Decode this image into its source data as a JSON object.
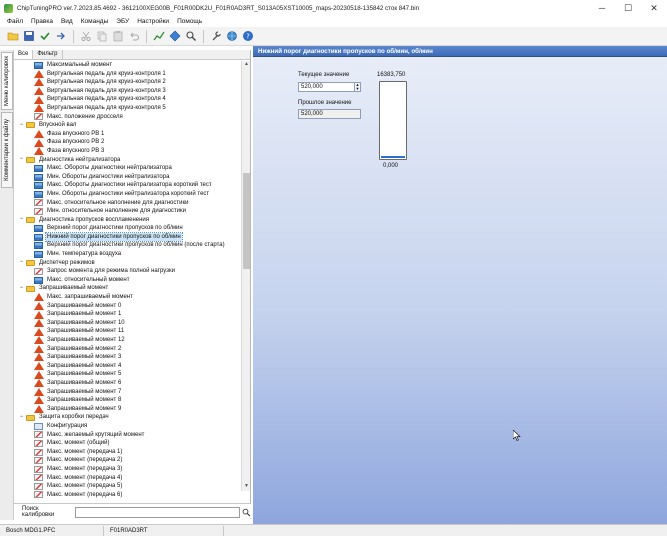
{
  "window": {
    "title": "ChipTuningPRO ver.7.2023.85.4692 - 3612100XEG00B_F01R00DK2U_F01R0AD3RT_S013A05XST10005_maps-20230518-135842 сток 847.bin",
    "minimize": "─",
    "maximize": "☐",
    "close": "✕"
  },
  "menu": {
    "items": [
      "Файл",
      "Правка",
      "Вид",
      "Команды",
      "ЭБУ",
      "Настройки",
      "Помощь"
    ]
  },
  "side_tabs": {
    "calibrations": "Меню калибровок",
    "comments": "Комментарии к файлу"
  },
  "left_tabs": {
    "all": "Все",
    "filter": "Фильтр"
  },
  "tree": [
    {
      "type": "map",
      "indent": 2,
      "label": "Максимальный момент"
    },
    {
      "type": "tri",
      "indent": 2,
      "label": "Виртуальная педаль для круиз-контроля 1"
    },
    {
      "type": "tri",
      "indent": 2,
      "label": "Виртуальная педаль для круиз-контроля 2"
    },
    {
      "type": "tri",
      "indent": 2,
      "label": "Виртуальная педаль для круиз-контроля 3"
    },
    {
      "type": "tri",
      "indent": 2,
      "label": "Виртуальная педаль для круиз-контроля 4"
    },
    {
      "type": "tri",
      "indent": 2,
      "label": "Виртуальная педаль для круиз-контроля 5"
    },
    {
      "type": "curve",
      "indent": 2,
      "label": "Макс. положение дросселя"
    },
    {
      "type": "folder",
      "indent": 0,
      "label": "Впускной вал"
    },
    {
      "type": "tri",
      "indent": 2,
      "label": "Фаза впускного РВ 1"
    },
    {
      "type": "tri",
      "indent": 2,
      "label": "Фаза впускного РВ 2"
    },
    {
      "type": "tri",
      "indent": 2,
      "label": "Фаза впускного РВ 3"
    },
    {
      "type": "folder",
      "indent": 0,
      "label": "Диагностика нейтрализатора"
    },
    {
      "type": "map",
      "indent": 2,
      "label": "Макс. Обороты диагностики нейтрализатора"
    },
    {
      "type": "map",
      "indent": 2,
      "label": "Мин. Обороты диагностики нейтрализатора"
    },
    {
      "type": "map",
      "indent": 2,
      "label": "Макс. Обороты диагностики нейтрализатора короткий тест"
    },
    {
      "type": "map",
      "indent": 2,
      "label": "Мин. Обороты диагностики нейтрализатора короткий тест"
    },
    {
      "type": "curve",
      "indent": 2,
      "label": "Макс. относительное наполнение для диагностики"
    },
    {
      "type": "curve",
      "indent": 2,
      "label": "Мин. относительное наполнение для диагностики"
    },
    {
      "type": "folder",
      "indent": 0,
      "label": "Диагностика пропусков воспламенения"
    },
    {
      "type": "map",
      "indent": 2,
      "label": "Верхний порог диагностики пропусков по об/мин"
    },
    {
      "type": "map",
      "indent": 2,
      "label": "Нижний порог диагностики пропусков по об/мин",
      "selected": true
    },
    {
      "type": "map",
      "indent": 2,
      "label": "Верхний порог диагностики пропусков по об/мин (после старта)"
    },
    {
      "type": "map",
      "indent": 2,
      "label": "Мин. температура воздуха"
    },
    {
      "type": "folder",
      "indent": 0,
      "label": "Диспетчер режимов"
    },
    {
      "type": "curve",
      "indent": 2,
      "label": "Запрос момента для режима полной нагрузки"
    },
    {
      "type": "map",
      "indent": 2,
      "label": "Макс. относительный момент"
    },
    {
      "type": "folder",
      "indent": 0,
      "label": "Запрашиваемый момент"
    },
    {
      "type": "tri",
      "indent": 2,
      "label": "Макс. запрашиваемый момент"
    },
    {
      "type": "tri",
      "indent": 2,
      "label": "Запрашиваемый момент 0"
    },
    {
      "type": "tri",
      "indent": 2,
      "label": "Запрашиваемый момент 1"
    },
    {
      "type": "tri",
      "indent": 2,
      "label": "Запрашиваемый момент 10"
    },
    {
      "type": "tri",
      "indent": 2,
      "label": "Запрашиваемый момент 11"
    },
    {
      "type": "tri",
      "indent": 2,
      "label": "Запрашиваемый момент 12"
    },
    {
      "type": "tri",
      "indent": 2,
      "label": "Запрашиваемый момент 2"
    },
    {
      "type": "tri",
      "indent": 2,
      "label": "Запрашиваемый момент 3"
    },
    {
      "type": "tri",
      "indent": 2,
      "label": "Запрашиваемый момент 4"
    },
    {
      "type": "tri",
      "indent": 2,
      "label": "Запрашиваемый момент 5"
    },
    {
      "type": "tri",
      "indent": 2,
      "label": "Запрашиваемый момент 6"
    },
    {
      "type": "tri",
      "indent": 2,
      "label": "Запрашиваемый момент 7"
    },
    {
      "type": "tri",
      "indent": 2,
      "label": "Запрашиваемый момент 8"
    },
    {
      "type": "tri",
      "indent": 2,
      "label": "Запрашиваемый момент 9"
    },
    {
      "type": "folder",
      "indent": 0,
      "label": "Защита коробки передач"
    },
    {
      "type": "param",
      "indent": 2,
      "label": "Конфигурация"
    },
    {
      "type": "curve",
      "indent": 2,
      "label": "Макс. желаемый крутящий момент"
    },
    {
      "type": "curve",
      "indent": 2,
      "label": "Макс. момент (общий)"
    },
    {
      "type": "curve",
      "indent": 2,
      "label": "Макс. момент (передача 1)"
    },
    {
      "type": "curve",
      "indent": 2,
      "label": "Макс. момент (передача 2)"
    },
    {
      "type": "curve",
      "indent": 2,
      "label": "Макс. момент (передача 3)"
    },
    {
      "type": "curve",
      "indent": 2,
      "label": "Макс. момент (передача 4)"
    },
    {
      "type": "curve",
      "indent": 2,
      "label": "Макс. момент (передача 5)"
    },
    {
      "type": "curve",
      "indent": 2,
      "label": "Макс. момент (передача 6)"
    }
  ],
  "search": {
    "label": "Поиск калибровки",
    "value": ""
  },
  "right": {
    "header": "Нижний порог диагностики пропусков по об/мин, об/мин",
    "current_label": "Текущее значение",
    "current_value": "520,000",
    "prev_label": "Прошлое значение",
    "prev_value": "520,000",
    "gauge_max": "16383,750",
    "gauge_min": "0,000",
    "gauge_level_fraction": 0.032
  },
  "status": {
    "ecu": "Bosch MDG1.PFC",
    "sw": "F01R0AD3RT"
  }
}
